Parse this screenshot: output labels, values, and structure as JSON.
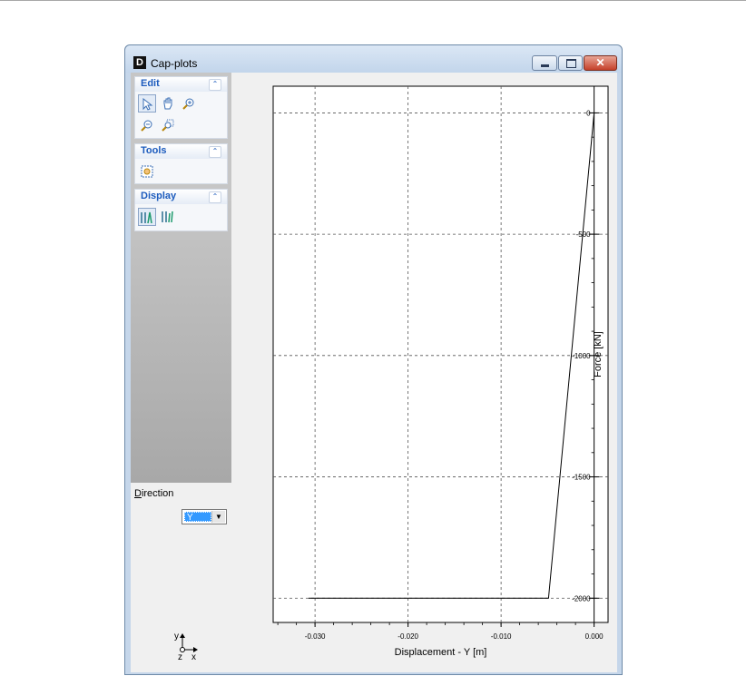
{
  "window": {
    "title": "Cap-plots",
    "app_icon_letter": "D",
    "minimize": "",
    "maximize": "",
    "close": "✕"
  },
  "left_panel": {
    "groups": [
      {
        "title": "Edit",
        "tools": [
          "select-icon",
          "pan-icon",
          "zoom-in-icon",
          "zoom-out-icon",
          "zoom-window-icon"
        ]
      },
      {
        "title": "Tools",
        "tools": [
          "export-icon"
        ]
      },
      {
        "title": "Display",
        "tools": [
          "display-mode-1-icon",
          "display-mode-2-icon"
        ]
      }
    ],
    "direction_label": "Direction",
    "direction_value": "Y"
  },
  "chart_data": {
    "type": "line",
    "xlabel": "Displacement  - Y [m]",
    "ylabel": "Force [kN]",
    "xlim": [
      -0.0345,
      0.0015
    ],
    "ylim": [
      -2100,
      110
    ],
    "x_ticks": [
      -0.03,
      -0.02,
      -0.01,
      0.0
    ],
    "x_tick_labels": [
      "-0.030",
      "-0.020",
      "-0.010",
      "0.000"
    ],
    "y_ticks": [
      0,
      -500,
      -1000,
      -1500,
      -2000
    ],
    "y_tick_labels": [
      "0",
      "-500",
      "-1000",
      "-1500",
      "-2000"
    ],
    "grid": true,
    "series": [
      {
        "x": [
          0.0,
          -0.0049,
          -0.0307
        ],
        "y": [
          0,
          -2000,
          -2000
        ]
      }
    ]
  }
}
